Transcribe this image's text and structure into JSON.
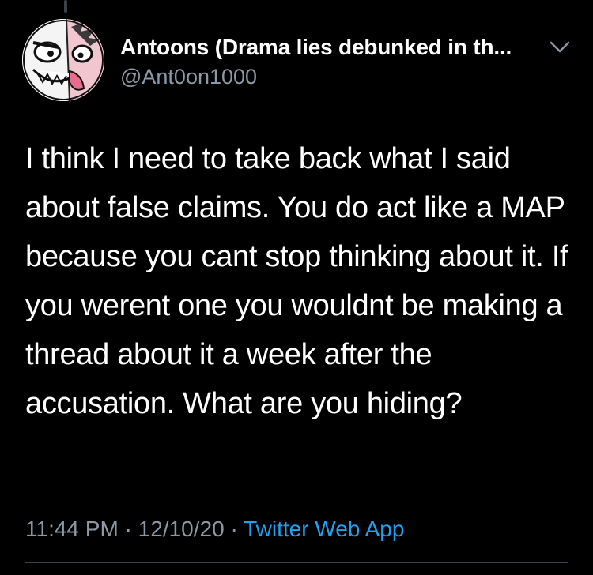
{
  "tweet": {
    "display_name": "Antoons (Drama lies debunked in th...",
    "handle": "@Ant0on1000",
    "text": "I think I need to take back what I said about false claims. You do act like a MAP because you cant stop thinking about it. If you werent one you wouldnt be making a thread about it a week after the accusation. What are you hiding?",
    "time": "11:44 PM",
    "separator": "·",
    "date": "12/10/20",
    "source": "Twitter Web App"
  },
  "icons": {
    "avatar": "cartoon-face-avatar",
    "more": "chevron-down-icon"
  },
  "colors": {
    "background": "#000000",
    "primary_text": "#ffffff",
    "secondary_text": "#8b98a5",
    "link": "#1da1f2",
    "divider": "#38444d"
  }
}
